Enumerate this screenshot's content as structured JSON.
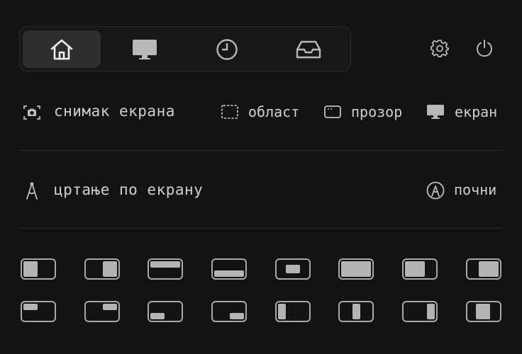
{
  "tabs": [
    {
      "id": "home",
      "icon": "home-icon",
      "active": true
    },
    {
      "id": "display",
      "icon": "monitor-icon",
      "active": false
    },
    {
      "id": "history",
      "icon": "clock-icon",
      "active": false
    },
    {
      "id": "inbox",
      "icon": "inbox-icon",
      "active": false
    }
  ],
  "header": {
    "settings_icon": "gear-icon",
    "power_icon": "power-icon"
  },
  "screenshot": {
    "label": "снимак екрана",
    "area_label": "област",
    "window_label": "прозор",
    "screen_label": "екран"
  },
  "drawing": {
    "label": "цртање по екрану",
    "start_label": "почни"
  },
  "window_layouts": [
    "left-half",
    "right-half",
    "top-half",
    "bottom-half",
    "center",
    "maximize",
    "left-two-thirds",
    "right-two-thirds",
    "top-left",
    "top-right",
    "bottom-left",
    "bottom-right",
    "first-third",
    "center-third",
    "last-third",
    "center-two-thirds"
  ]
}
